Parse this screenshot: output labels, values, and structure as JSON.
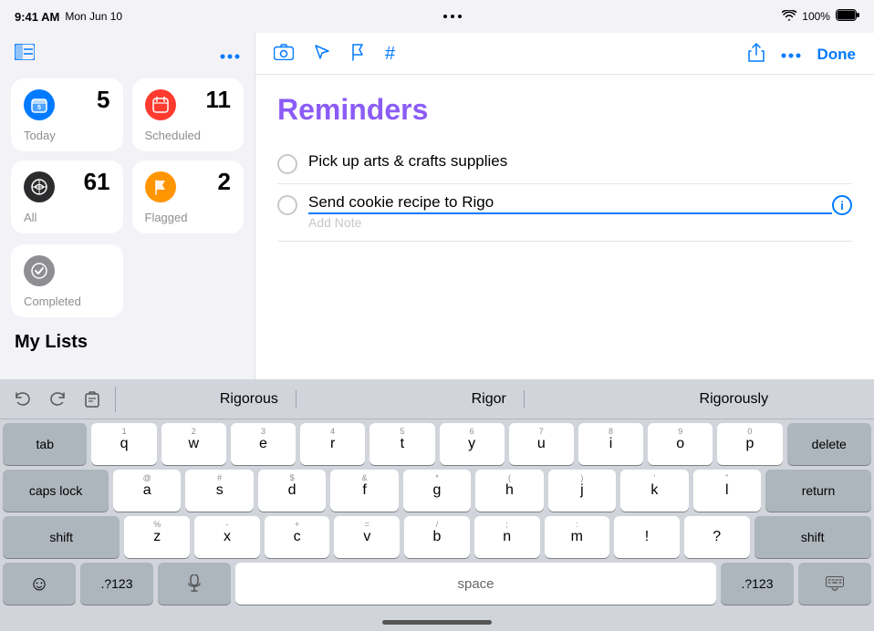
{
  "statusBar": {
    "time": "9:41 AM",
    "date": "Mon Jun 10",
    "wifi": "WiFi",
    "battery": "100%"
  },
  "sidebar": {
    "ellipsisIcon": "⋯",
    "sidebarIcon": "⊟",
    "smartLists": [
      {
        "id": "today",
        "label": "Today",
        "count": "5",
        "iconType": "blue",
        "iconChar": "🗓"
      },
      {
        "id": "scheduled",
        "label": "Scheduled",
        "count": "11",
        "iconType": "red",
        "iconChar": "📅"
      },
      {
        "id": "all",
        "label": "All",
        "count": "61",
        "iconType": "dark",
        "iconChar": "∞"
      },
      {
        "id": "flagged",
        "label": "Flagged",
        "count": "2",
        "iconType": "orange",
        "iconChar": "⚑"
      }
    ],
    "completed": {
      "label": "Completed",
      "iconType": "gray",
      "iconChar": "✓"
    },
    "myListsLabel": "My Lists"
  },
  "detail": {
    "toolbar": {
      "icons": [
        "camera-icon",
        "location-arrow-icon",
        "flag-icon",
        "hash-icon"
      ],
      "shareIcon": "share-icon",
      "moreIcon": "more-icon",
      "doneLabel": "Done"
    },
    "title": "Reminders",
    "items": [
      {
        "id": "item1",
        "text": "Pick up arts & crafts supplies",
        "completed": false
      },
      {
        "id": "item2",
        "text": "Send cookie recipe to Rigo",
        "addNote": "Add Note",
        "completed": false,
        "active": true
      }
    ]
  },
  "keyboard": {
    "autocomplete": {
      "suggestions": [
        "Rigorous",
        "Rigor",
        "Rigorously"
      ]
    },
    "rows": [
      {
        "keys": [
          {
            "label": "tab",
            "type": "special",
            "size": "tab",
            "number": ""
          },
          {
            "label": "q",
            "type": "letter",
            "number": "1"
          },
          {
            "label": "w",
            "type": "letter",
            "number": "2"
          },
          {
            "label": "e",
            "type": "letter",
            "number": "3"
          },
          {
            "label": "r",
            "type": "letter",
            "number": "4"
          },
          {
            "label": "t",
            "type": "letter",
            "number": "5"
          },
          {
            "label": "y",
            "type": "letter",
            "number": "6"
          },
          {
            "label": "u",
            "type": "letter",
            "number": "7"
          },
          {
            "label": "i",
            "type": "letter",
            "number": "8"
          },
          {
            "label": "o",
            "type": "letter",
            "number": "9"
          },
          {
            "label": "p",
            "type": "letter",
            "number": "0"
          },
          {
            "label": "delete",
            "type": "special",
            "size": "delete",
            "number": ""
          }
        ]
      },
      {
        "keys": [
          {
            "label": "caps lock",
            "type": "special",
            "size": "capslock",
            "number": ""
          },
          {
            "label": "a",
            "type": "letter",
            "number": "@"
          },
          {
            "label": "s",
            "type": "letter",
            "number": "#"
          },
          {
            "label": "d",
            "type": "letter",
            "number": "$"
          },
          {
            "label": "f",
            "type": "letter",
            "number": "&"
          },
          {
            "label": "g",
            "type": "letter",
            "number": "*"
          },
          {
            "label": "h",
            "type": "letter",
            "number": "("
          },
          {
            "label": "j",
            "type": "letter",
            "number": ")"
          },
          {
            "label": "k",
            "type": "letter",
            "number": "'"
          },
          {
            "label": "l",
            "type": "letter",
            "number": "\""
          },
          {
            "label": "return",
            "type": "special",
            "size": "return",
            "number": ""
          }
        ]
      },
      {
        "keys": [
          {
            "label": "shift",
            "type": "special",
            "size": "shift",
            "number": ""
          },
          {
            "label": "z",
            "type": "letter",
            "number": "%"
          },
          {
            "label": "x",
            "type": "letter",
            "number": "-"
          },
          {
            "label": "c",
            "type": "letter",
            "number": "+"
          },
          {
            "label": "v",
            "type": "letter",
            "number": "="
          },
          {
            "label": "b",
            "type": "letter",
            "number": "/"
          },
          {
            "label": "n",
            "type": "letter",
            "number": ";"
          },
          {
            "label": "m",
            "type": "letter",
            "number": ":"
          },
          {
            "label": "!",
            "type": "letter",
            "number": ""
          },
          {
            "label": "?",
            "type": "letter",
            "number": ""
          },
          {
            "label": "shift",
            "type": "special",
            "size": "shift-right",
            "number": ""
          }
        ]
      },
      {
        "keys": [
          {
            "label": "☺",
            "type": "special",
            "size": "emoji"
          },
          {
            "label": ".?123",
            "type": "special",
            "size": "123"
          },
          {
            "label": "🎤",
            "type": "special",
            "size": "mic"
          },
          {
            "label": "space",
            "type": "letter",
            "size": "space"
          },
          {
            "label": ".?123",
            "type": "special",
            "size": "123-right"
          },
          {
            "label": "⌨",
            "type": "special",
            "size": "hide-kb"
          }
        ]
      }
    ]
  }
}
